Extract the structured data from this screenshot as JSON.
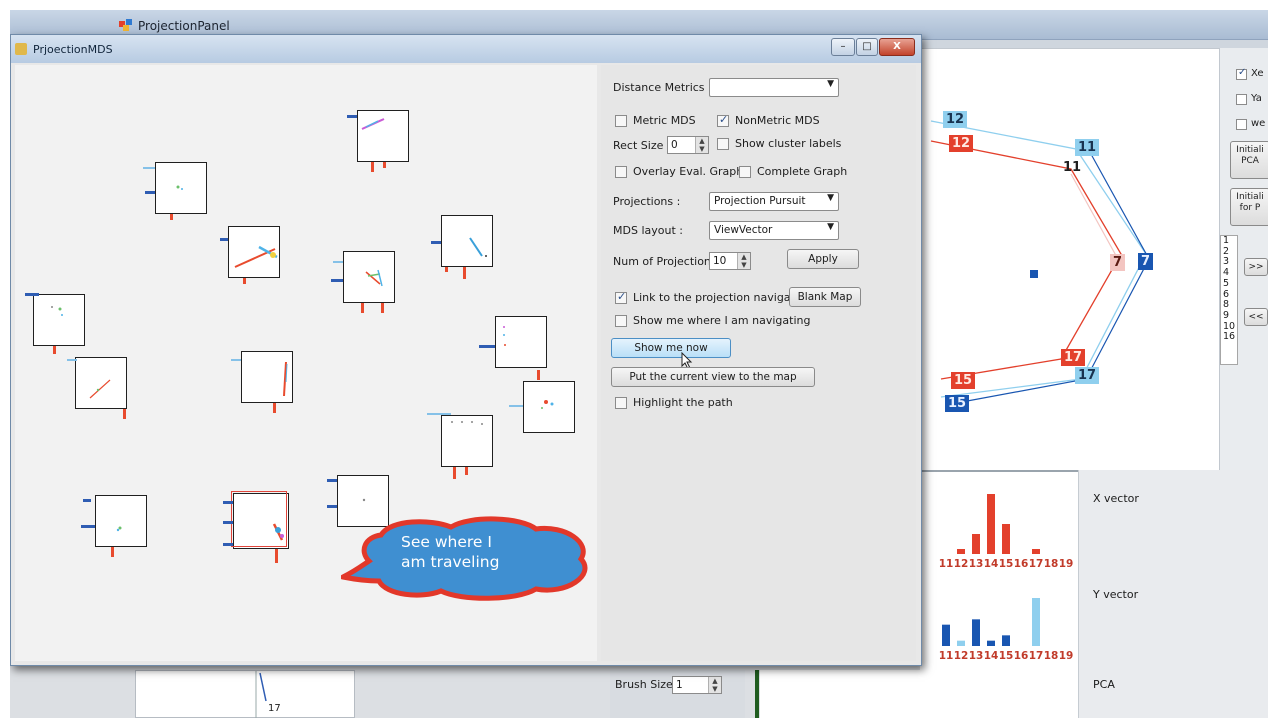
{
  "background_window": {
    "title": "ProjectionPanel",
    "brush_size_label": "Brush Size",
    "brush_size_value": "1",
    "bottom_label": "17"
  },
  "dialog": {
    "title": "PrjoectionMDS",
    "window_buttons": {
      "minimize": "–",
      "maximize": "□",
      "close": "X"
    },
    "controls": {
      "distance_metrics_label": "Distance Metrics :",
      "distance_metrics_value": "",
      "metric_mds_label": "Metric MDS",
      "metric_mds_checked": false,
      "nonmetric_mds_label": "NonMetric MDS",
      "nonmetric_mds_checked": true,
      "rect_size_label": "Rect Size",
      "rect_size_value": "0",
      "show_cluster_labels_label": "Show cluster labels",
      "show_cluster_labels_checked": false,
      "overlay_eval_graph_label": "Overlay Eval. Graph",
      "overlay_eval_graph_checked": false,
      "complete_graph_label": "Complete Graph",
      "complete_graph_checked": false,
      "projections_label": "Projections :",
      "projections_value": "Projection Pursuit",
      "mds_layout_label": "MDS layout :",
      "mds_layout_value": "ViewVector",
      "num_projections_label": "Num of Projections :",
      "num_projections_value": "10",
      "apply_button": "Apply",
      "link_navigator_label": "Link to the projection navigator",
      "link_navigator_checked": true,
      "blank_map_button": "Blank Map",
      "show_where_label": "Show me where I am navigating",
      "show_where_checked": false,
      "show_me_now_button": "Show me now",
      "put_view_button": "Put the current view to the map",
      "highlight_path_label": "Highlight the path",
      "highlight_path_checked": false
    },
    "callout_text": "See where I am traveling"
  },
  "navigator_map": {
    "nodes": {
      "lb_12": "12",
      "red_12": "12",
      "lb_11": "11",
      "text_11": "11",
      "pink_7": "7",
      "blue_7": "7",
      "red_17": "17",
      "lb_17": "17",
      "red_15": "15",
      "blue_15": "15"
    },
    "colors": {
      "light_blue": "#8fcfee",
      "red": "#e3402c",
      "pink": "#f3c5c1",
      "blue": "#1956b1"
    }
  },
  "right_panel": {
    "checkboxes": [
      {
        "label": "Xe",
        "checked": true
      },
      {
        "label": "Ya",
        "checked": false
      },
      {
        "label": "we",
        "checked": false
      }
    ],
    "buttons": [
      {
        "label": "Initiali\nPCA"
      },
      {
        "label": "Initiali\nfor P"
      }
    ],
    "nav_buttons": {
      "forward": ">>",
      "back": "<<"
    },
    "list_items": [
      "1",
      "2",
      "3",
      "4",
      "5",
      "6",
      "8",
      "9",
      "10",
      "16"
    ]
  },
  "chart_data": [
    {
      "type": "bar",
      "categories": [
        "11",
        "12",
        "13",
        "14",
        "15",
        "16",
        "17",
        "18",
        "19"
      ],
      "values": [
        0,
        1,
        4,
        12,
        6,
        0,
        1,
        0,
        0
      ],
      "series_label": "X vector"
    },
    {
      "type": "bar",
      "categories": [
        "11",
        "12",
        "13",
        "14",
        "15",
        "16",
        "17",
        "18",
        "19"
      ],
      "series": [
        {
          "name": "dark",
          "values": [
            4,
            0,
            5,
            1,
            2,
            0,
            0,
            0,
            0
          ]
        },
        {
          "name": "light",
          "values": [
            0,
            1,
            0,
            0,
            0,
            0,
            9,
            0,
            0
          ]
        }
      ],
      "series_label": "Y vector"
    },
    {
      "type": "bar",
      "categories": [],
      "values": [],
      "series_label": "PCA"
    }
  ]
}
